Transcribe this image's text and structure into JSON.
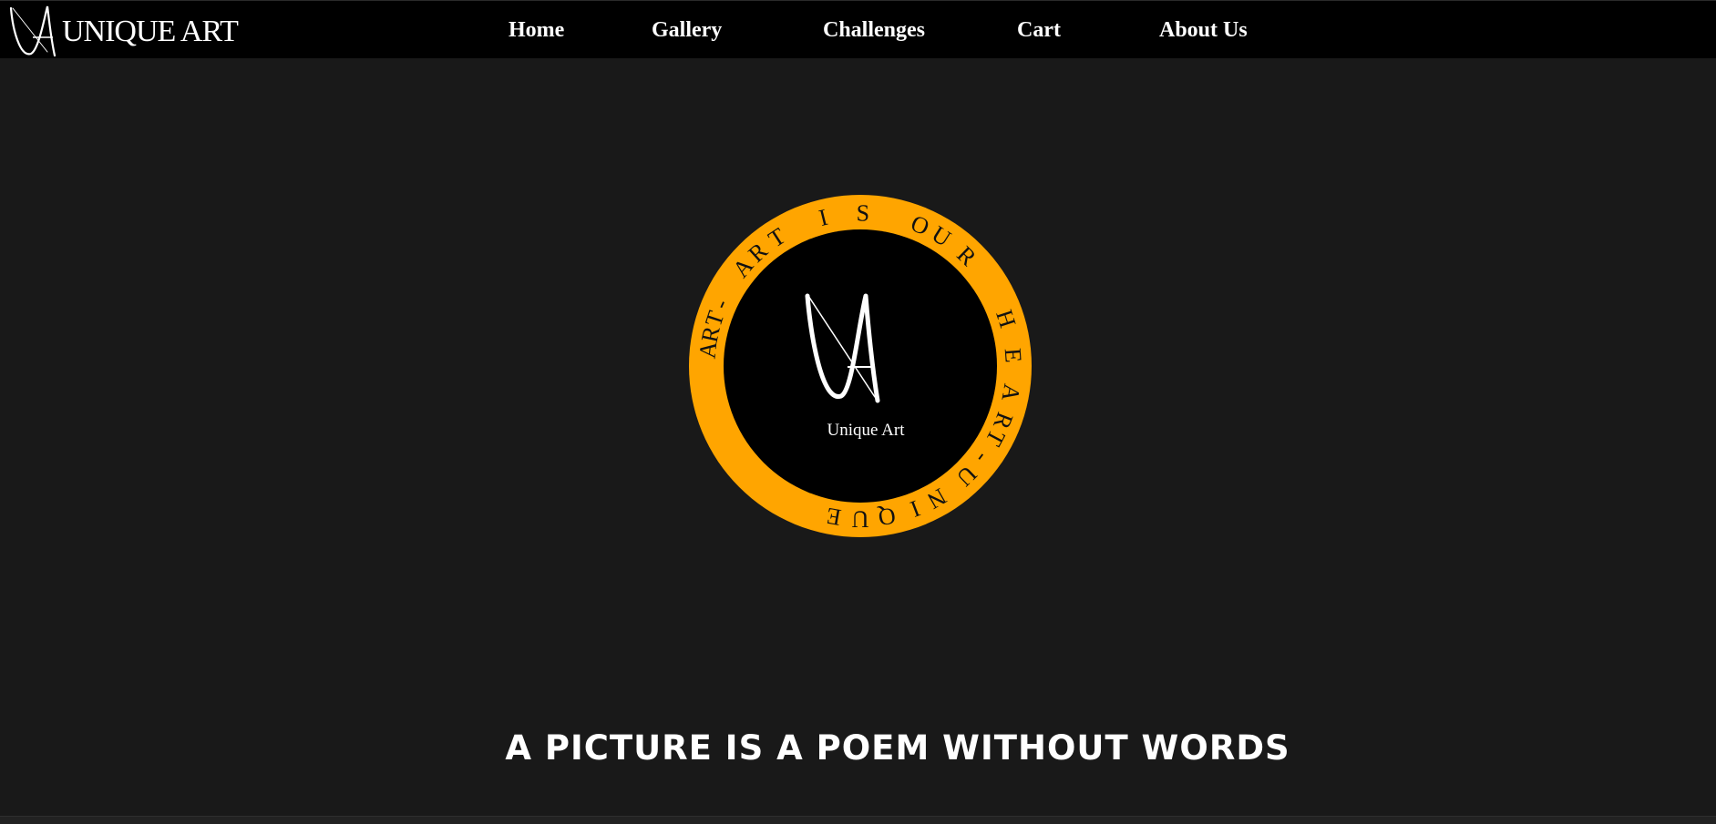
{
  "colors": {
    "page_background": "#191919",
    "navbar_background": "#000000",
    "emblem_ring": "#FFA500",
    "emblem_center": "#000000",
    "text": "#FFFFFF"
  },
  "header": {
    "logo_text": "UNIQUE ART",
    "logo_icon": "ua-monogram-icon",
    "nav": [
      {
        "label": "Home"
      },
      {
        "label": "Gallery"
      },
      {
        "label": "Challenges"
      },
      {
        "label": "Cart"
      },
      {
        "label": "About Us"
      }
    ]
  },
  "emblem": {
    "ring_text": "ART - ART IS OUR HEART - UNIQUE",
    "ring_letters": [
      "A",
      "R",
      "T",
      "-",
      "A",
      "R",
      "T",
      "I",
      "S",
      "O",
      "U",
      "R",
      "H",
      "E",
      "A",
      "R",
      "T",
      "-",
      "U",
      "N",
      "I",
      "Q",
      "U",
      "E"
    ],
    "center_caption": "Unique Art",
    "icon": "ua-monogram-icon"
  },
  "hero": {
    "tagline": "A picture is a poem without words"
  }
}
